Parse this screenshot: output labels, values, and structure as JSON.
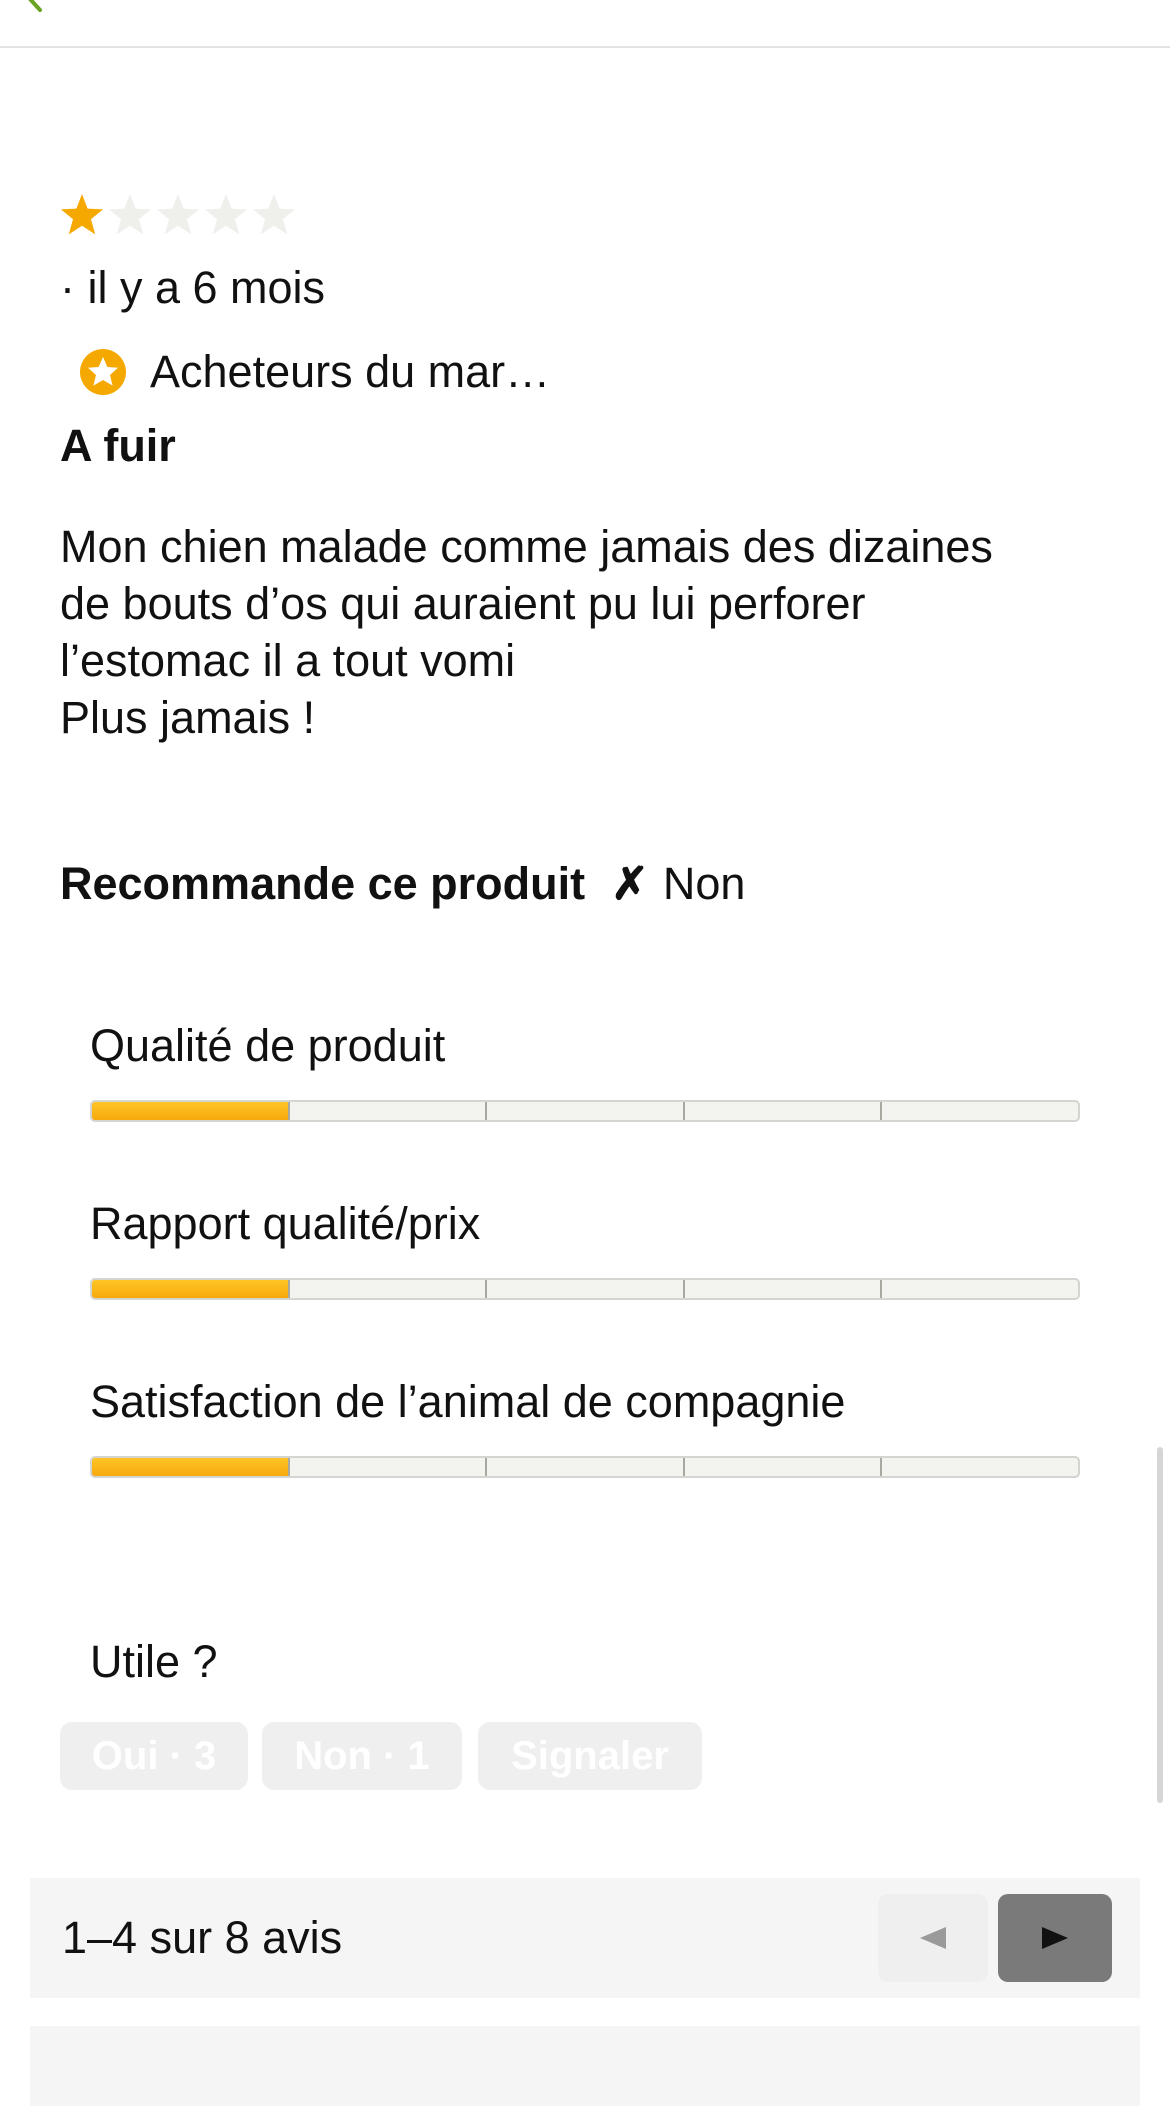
{
  "review": {
    "rating": 1,
    "max_rating": 5,
    "author": "",
    "time_ago": "· il y a 6 mois",
    "badge": "Acheteurs du mar…",
    "title": "A fuir",
    "body": "Mon chien malade comme jamais des dizaines\nde bouts d’os qui auraient pu lui perforer\nl’estomac il a tout vomi\nPlus jamais !",
    "recommend_label": "Recommande ce produit",
    "recommend_icon": "✗",
    "recommend_value": "Non"
  },
  "ratings": [
    {
      "label": "Qualité de produit",
      "value": 1,
      "max": 5
    },
    {
      "label": "Rapport qualité/prix",
      "value": 1,
      "max": 5
    },
    {
      "label": "Satisfaction de l’animal de compagnie",
      "value": 1,
      "max": 5
    }
  ],
  "helpful": {
    "question": "Utile ?",
    "yes_label": "Oui · 3",
    "no_label": "Non · 1",
    "report_label": "Signaler"
  },
  "pagination": {
    "summary": "1–4 sur 8 avis"
  },
  "colors": {
    "accent": "#f5a900",
    "star_empty": "#efefec",
    "back_icon": "#6aa322"
  },
  "icons": {
    "back": "chevron-left-icon",
    "star": "star-icon",
    "badge": "star-badge-icon",
    "prev": "triangle-left-icon",
    "next": "triangle-right-icon"
  }
}
